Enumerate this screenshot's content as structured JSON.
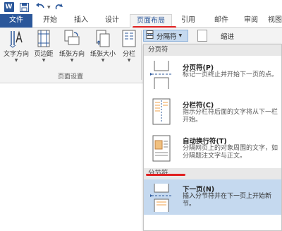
{
  "qat": {
    "word_logo": "W",
    "icons": [
      "word-icon",
      "save-icon",
      "undo-icon",
      "redo-icon"
    ]
  },
  "tabs": [
    {
      "label": "文件",
      "active": false
    },
    {
      "label": "开始",
      "active": false
    },
    {
      "label": "插入",
      "active": false
    },
    {
      "label": "设计",
      "active": false
    },
    {
      "label": "页面布局",
      "active": true
    },
    {
      "label": "引用",
      "active": false
    },
    {
      "label": "邮件",
      "active": false
    },
    {
      "label": "审阅",
      "active": false
    },
    {
      "label": "视图",
      "active": false
    }
  ],
  "ribbon": {
    "buttons": [
      {
        "label": "文字方向",
        "icon": "text-direction-icon"
      },
      {
        "label": "页边距",
        "icon": "margins-icon"
      },
      {
        "label": "纸张方向",
        "icon": "orientation-icon"
      },
      {
        "label": "纸张大小",
        "icon": "size-icon"
      },
      {
        "label": "分栏",
        "icon": "columns-icon"
      }
    ],
    "group_label": "页面设置",
    "breaks_button": "分隔符",
    "indent_label": "缩进"
  },
  "dropdown": {
    "page_breaks_header": "分页符",
    "section_breaks_header": "分节符",
    "items": [
      {
        "title": "分页符(P)",
        "desc": "标记一页终止并开始下一页的点。",
        "icon": "page-break-icon",
        "selected": false
      },
      {
        "title": "分栏符(C)",
        "desc": "指示分栏符后面的文字将从下一栏开始。",
        "icon": "column-break-icon",
        "selected": false
      },
      {
        "title": "自动换行符(T)",
        "desc": "分隔网页上的对象周围的文字，如分隔题注文字与正文。",
        "icon": "text-wrapping-icon",
        "selected": false
      },
      {
        "title": "下一页(N)",
        "desc": "插入分节符并在下一页上开始新节。",
        "icon": "next-page-icon",
        "selected": true
      }
    ]
  },
  "colors": {
    "accent": "#2b579a",
    "highlight": "#c5d9ef",
    "annotation_red": "#e02020"
  }
}
